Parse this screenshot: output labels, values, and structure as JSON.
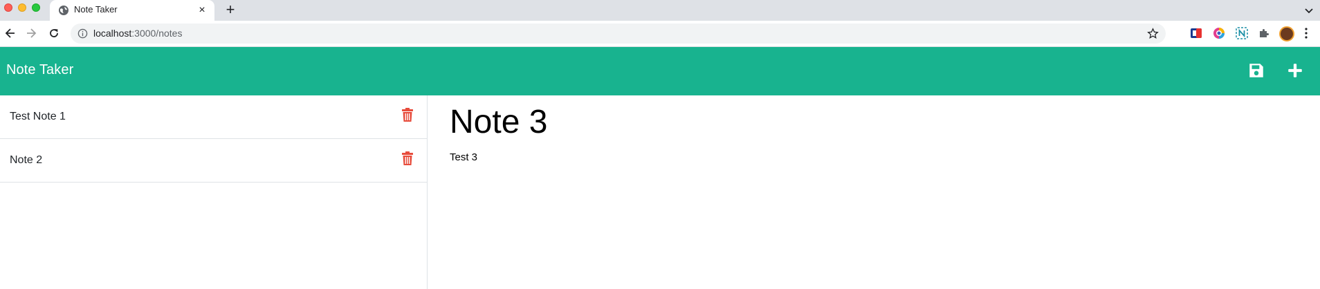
{
  "browser": {
    "tab_title": "Note Taker",
    "tab_close": "×",
    "new_tab": "+",
    "url_host": "localhost",
    "url_path": ":3000/notes"
  },
  "app": {
    "title": "Note Taker",
    "accent_color": "#18b38f",
    "delete_color": "#e74c3c",
    "icons": {
      "save": "save-icon",
      "add": "plus-icon",
      "delete": "trash-icon"
    }
  },
  "notes": [
    {
      "title": "Test Note 1"
    },
    {
      "title": "Note 2"
    }
  ],
  "active_note": {
    "title": "Note 3",
    "text": "Test 3"
  }
}
